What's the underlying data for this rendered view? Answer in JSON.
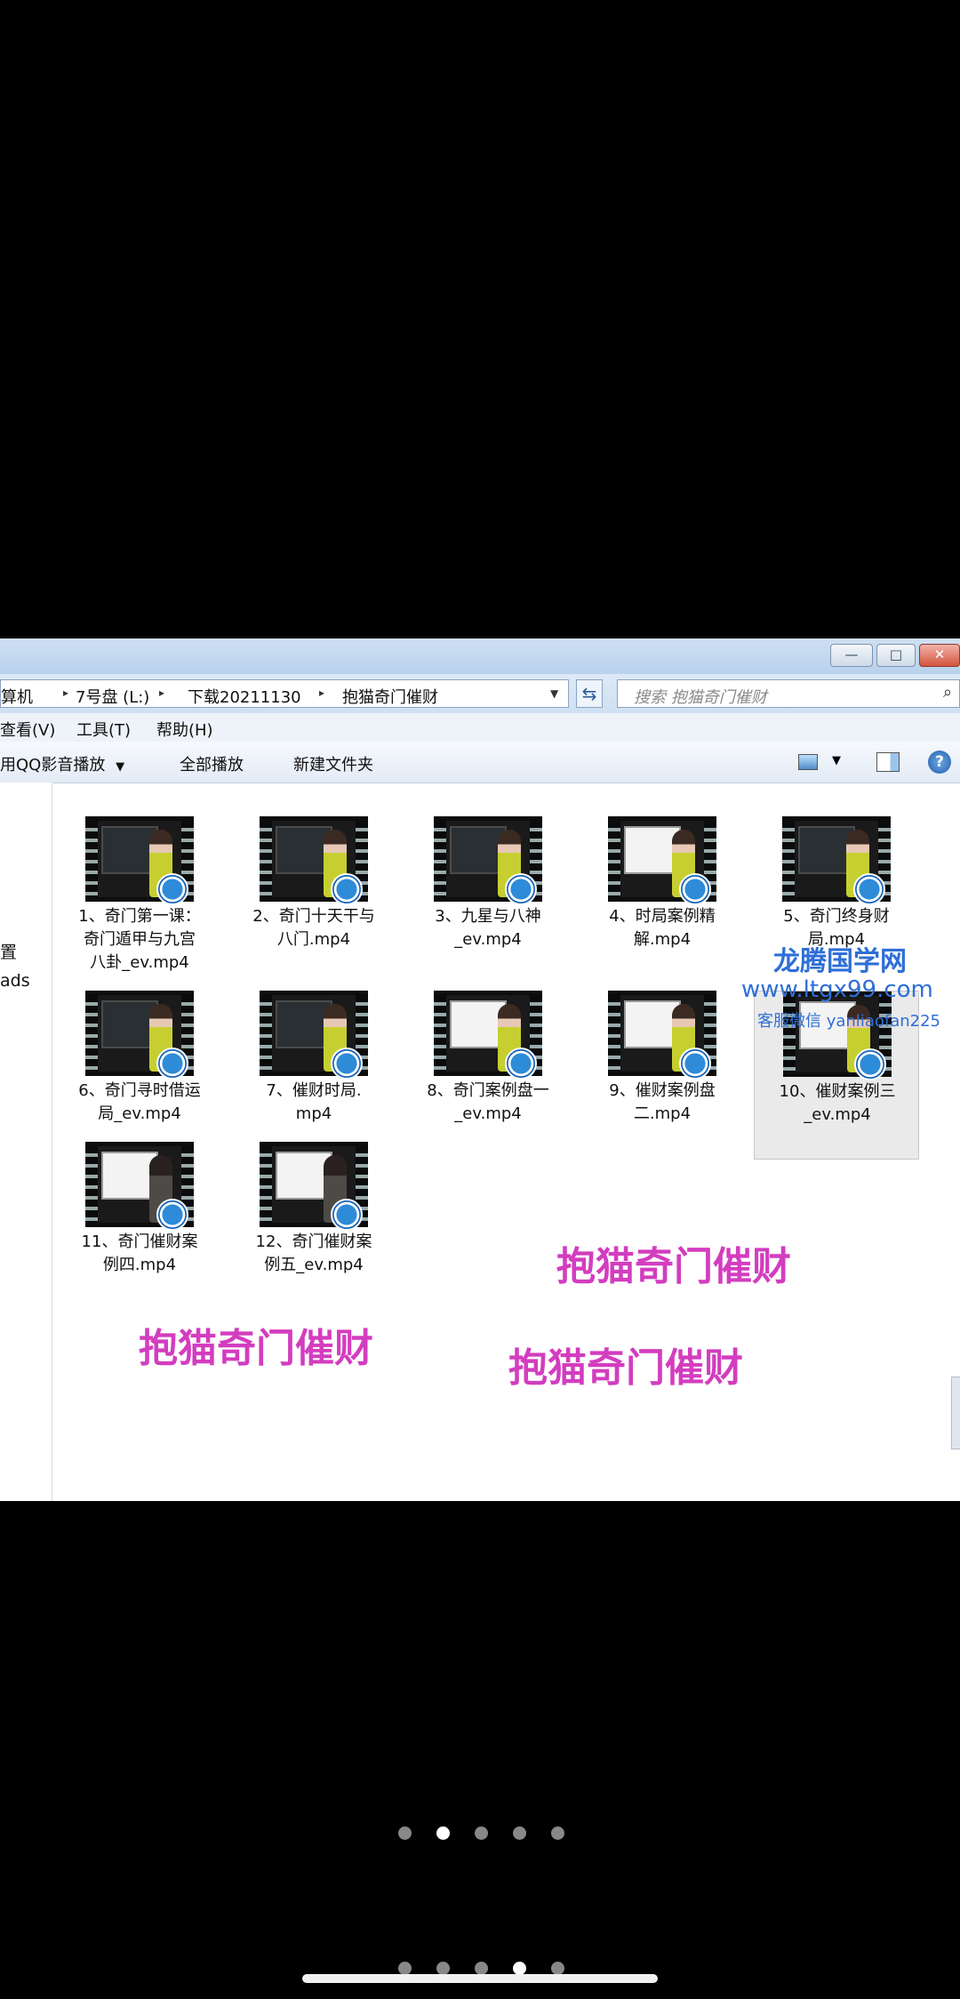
{
  "window": {
    "minimize_symbol": "—",
    "maximize_symbol": "□",
    "close_symbol": "✕"
  },
  "address": {
    "crumbs": [
      "算机",
      "7号盘 (L:)",
      "下载20211130",
      "抱猫奇门催财"
    ],
    "separator": "▸",
    "dropdown_symbol": "▼",
    "refresh_symbol": "⇆"
  },
  "search": {
    "placeholder": "搜索 抱猫奇门催财",
    "icon": "search-icon"
  },
  "menu": [
    "查看(V)",
    "工具(T)",
    "帮助(H)"
  ],
  "toolbar": {
    "open_with": "用QQ影音播放",
    "open_with_arrow": "▼",
    "play_all": "全部播放",
    "new_folder": "新建文件夹",
    "view_arrow": "▼",
    "help": "?"
  },
  "nav": {
    "item1": "置",
    "item2": "ads"
  },
  "files": [
    {
      "line1": "1、奇门第一课：",
      "line2": "奇门遁甲与九宫",
      "line3": "八卦_ev.mp4"
    },
    {
      "line1": "2、奇门十天干与",
      "line2": "八门.mp4",
      "line3": ""
    },
    {
      "line1": "3、九星与八神",
      "line2": "_ev.mp4",
      "line3": ""
    },
    {
      "line1": "4、时局案例精",
      "line2": "解.mp4",
      "line3": ""
    },
    {
      "line1": "5、奇门终身财",
      "line2": "局.mp4",
      "line3": ""
    },
    {
      "line1": "6、奇门寻时借运",
      "line2": "局_ev.mp4",
      "line3": ""
    },
    {
      "line1": "7、催财时局.",
      "line2": "mp4",
      "line3": ""
    },
    {
      "line1": "8、奇门案例盘一",
      "line2": "_ev.mp4",
      "line3": ""
    },
    {
      "line1": "9、催财案例盘",
      "line2": "二.mp4",
      "line3": ""
    },
    {
      "line1": "10、催财案例三",
      "line2": "_ev.mp4",
      "line3": ""
    },
    {
      "line1": "11、奇门催财案",
      "line2": "例四.mp4",
      "line3": ""
    },
    {
      "line1": "12、奇门催财案",
      "line2": "例五_ev.mp4",
      "line3": ""
    }
  ],
  "watermarks": {
    "text1": "抱猫奇门催财",
    "text2": "抱猫奇门催财",
    "text3": "抱猫奇门催财",
    "site": "龙腾国学网",
    "url": "www.ltgx99.com",
    "contact": "客服微信 yanliaofan225"
  },
  "colors": {
    "watermark_pink": "#d33dbf",
    "watermark_blue": "#2f6fd6",
    "titlebar": "#b9d1ec"
  }
}
